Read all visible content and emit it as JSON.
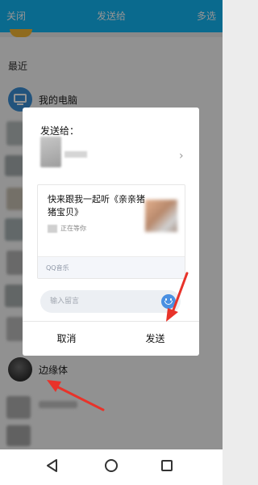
{
  "header": {
    "close_label": "关闭",
    "title": "发送给",
    "multi_select_label": "多选"
  },
  "list": {
    "section_label": "最近",
    "my_computer": "我的电脑",
    "contact_name": "边缘体"
  },
  "dialog": {
    "title": "发送给：",
    "card": {
      "title": "快来跟我一起听《亲亲猪猪宝贝》",
      "subtitle": "正在等你",
      "source": "QQ音乐"
    },
    "message_placeholder": "输入留言",
    "cancel_label": "取消",
    "send_label": "发送"
  },
  "icons": {
    "chevron": "›",
    "back": "back-triangle-icon",
    "home": "home-circle-icon",
    "recent": "recent-square-icon",
    "emoji": "emoji-icon"
  },
  "colors": {
    "header": "#12b7f5",
    "annotation_arrow": "#e8332a",
    "emoji": "#4a90e2"
  }
}
